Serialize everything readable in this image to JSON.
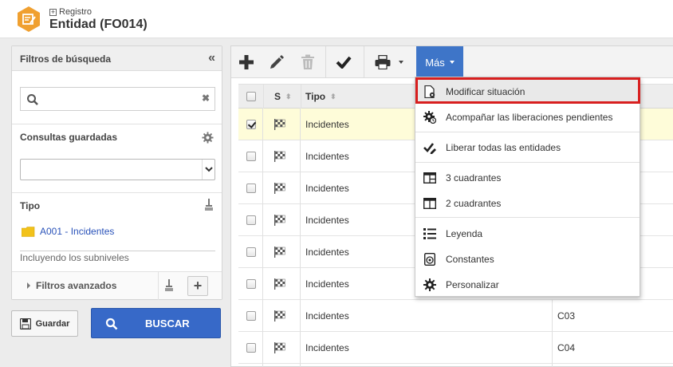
{
  "header": {
    "breadcrumb": "Registro",
    "title": "Entidad (FO014)"
  },
  "filters": {
    "title": "Filtros de búsqueda",
    "collapse_glyph": "«",
    "search_placeholder": "",
    "clear_glyph": "✖",
    "saved_queries_label": "Consultas guardadas",
    "saved_queries_value": "",
    "type_label": "Tipo",
    "type_item": "A001 - Incidentes",
    "include_sublevels": "Incluyendo los subniveles",
    "advanced_label": "Filtros avanzados",
    "add_glyph": "+"
  },
  "actions": {
    "save_label": "Guardar",
    "search_label": "BUSCAR"
  },
  "toolbar": {
    "more_label": "Más"
  },
  "table": {
    "columns": [
      "S",
      "Tipo"
    ],
    "rows": [
      {
        "tipo": "Incidentes",
        "code": "",
        "checked": true
      },
      {
        "tipo": "Incidentes",
        "code": "",
        "checked": false
      },
      {
        "tipo": "Incidentes",
        "code": "",
        "checked": false
      },
      {
        "tipo": "Incidentes",
        "code": "",
        "checked": false
      },
      {
        "tipo": "Incidentes",
        "code": "",
        "checked": false
      },
      {
        "tipo": "Incidentes",
        "code": "",
        "checked": false
      },
      {
        "tipo": "Incidentes",
        "code": "C03",
        "checked": false
      },
      {
        "tipo": "Incidentes",
        "code": "C04",
        "checked": false
      }
    ]
  },
  "menu": {
    "items": [
      {
        "label": "Modificar situación",
        "icon": "doc-gear-icon"
      },
      {
        "label": "Acompañar las liberaciones pendientes",
        "icon": "gear-badge-icon"
      },
      {
        "label": "Liberar todas las entidades",
        "icon": "check-edit-icon"
      },
      {
        "label": "3 cuadrantes",
        "icon": "three-quadrants-icon"
      },
      {
        "label": "2 cuadrantes",
        "icon": "two-quadrants-icon"
      },
      {
        "label": "Leyenda",
        "icon": "list-icon"
      },
      {
        "label": "Constantes",
        "icon": "constants-icon"
      },
      {
        "label": "Personalizar",
        "icon": "gear-icon"
      }
    ]
  },
  "colors": {
    "accent": "#3e75c8",
    "search_button": "#3769c8",
    "highlight_frame": "#d81f1f",
    "selected_row": "#fefcd9",
    "logo": "#f0a030"
  }
}
